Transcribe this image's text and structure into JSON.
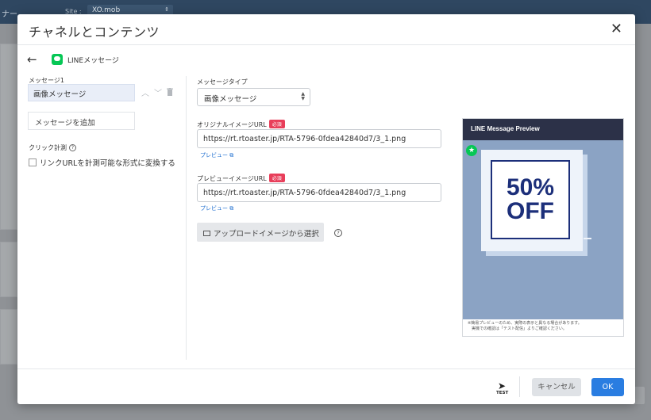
{
  "background": {
    "site_label": "Site :",
    "site_value": "XO.mob",
    "brand": "ナー"
  },
  "modal": {
    "title": "チャネルとコンテンツ",
    "close_glyph": "✕",
    "channel_label": "LINEメッセージ",
    "back_glyph": "←"
  },
  "left": {
    "message_label": "メッセージ1",
    "message_item": "画像メッセージ",
    "add_message": "メッセージを追加",
    "click_tracking_label": "クリック計測",
    "checkbox_label": "リンクURLを計測可能な形式に変換する",
    "up_glyph": "︿",
    "down_glyph": "﹀",
    "trash_glyph": "🗑"
  },
  "form": {
    "message_type_label": "メッセージタイプ",
    "message_type_value": "画像メッセージ",
    "original_url_label": "オリジナルイメージURL",
    "original_url_value": "https://rt.rtoaster.jp/RTA-5796-0fdea42840d7/3_1.png",
    "preview_url_label": "プレビューイメージURL",
    "preview_url_value": "https://rt.rtoaster.jp/RTA-5796-0fdea42840d7/3_1.png",
    "required_badge": "必須",
    "preview_link": "プレビュー",
    "upload_button": "アップロードイメージから選択"
  },
  "preview": {
    "header": "LINE Message Preview",
    "promo_line1": "50%",
    "promo_line2": "OFF",
    "note": "※簡易プレビューのため、実際の表示と異なる場合があります。\n　実機での確認は「テスト配信」よりご確認ください。"
  },
  "footer": {
    "test_label": "TEST",
    "cancel": "キャンセル",
    "ok": "OK"
  },
  "colors": {
    "ok_button": "#2a7de1",
    "required_badge": "#e83e5a",
    "line_green": "#06c755",
    "preview_header": "#2c3148",
    "preview_body": "#8ba3c4"
  }
}
